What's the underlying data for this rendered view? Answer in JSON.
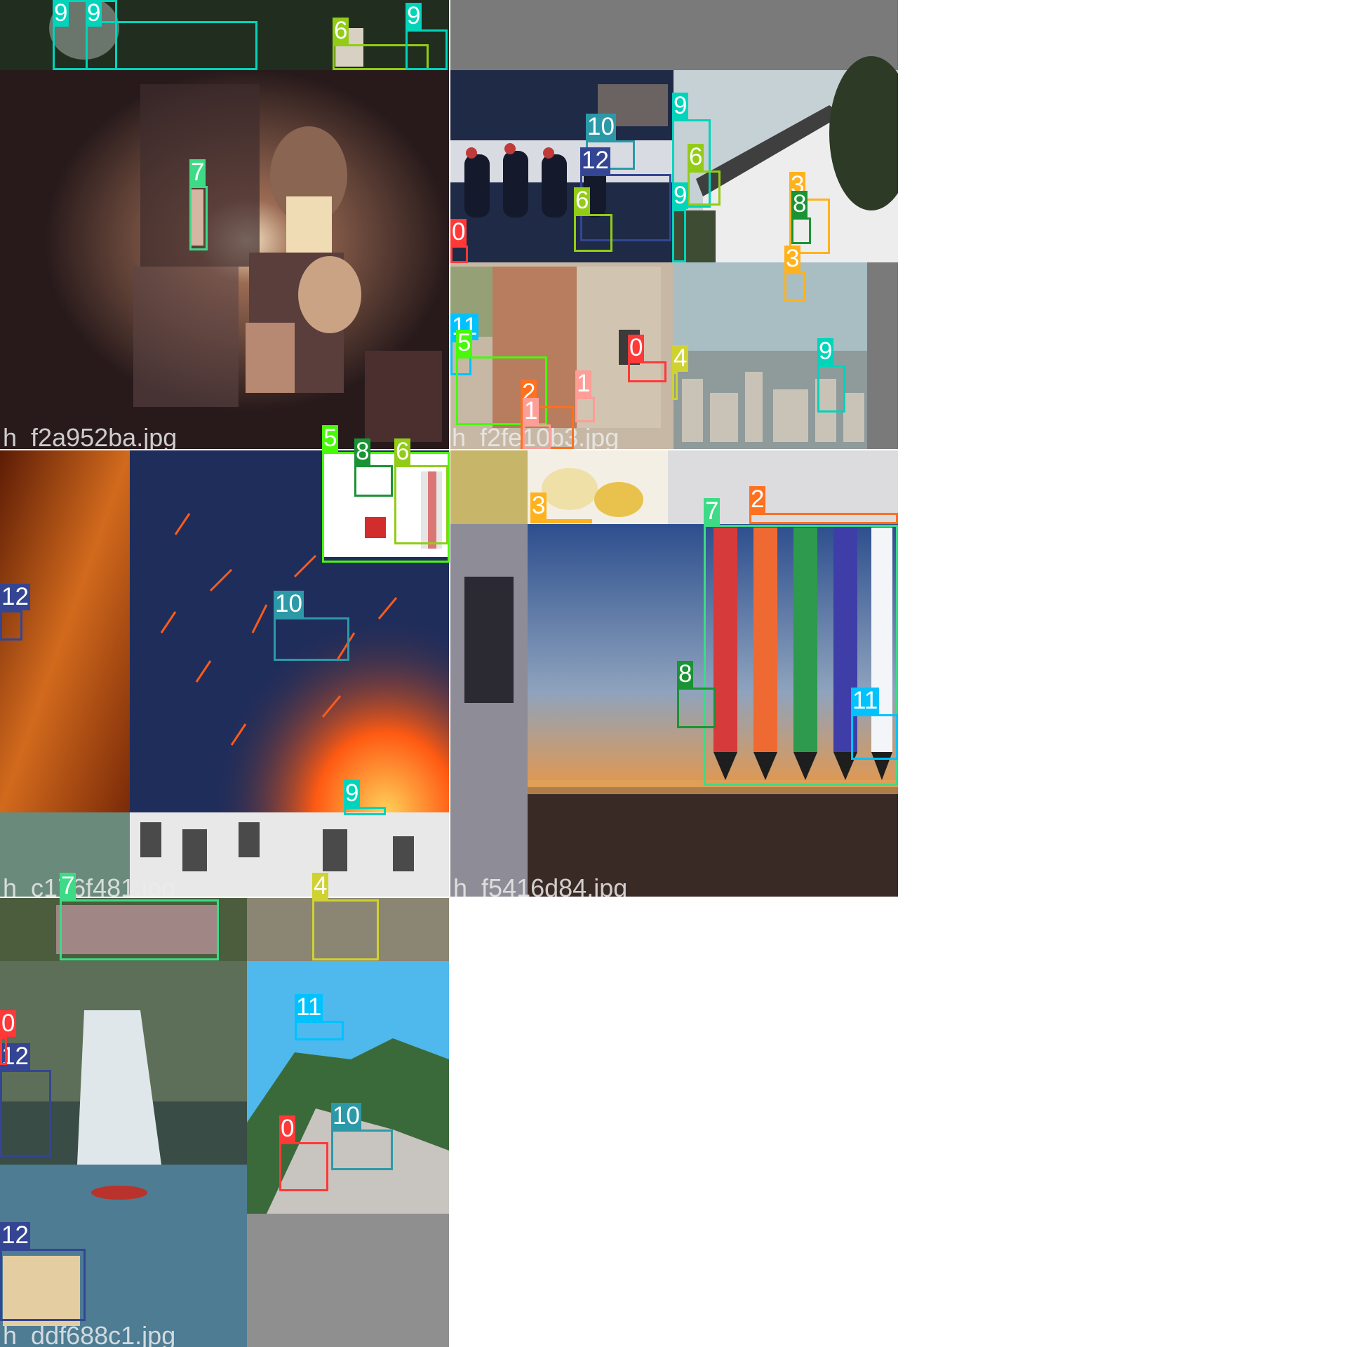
{
  "filenames": {
    "tile1": "h_f2a952ba.jpg",
    "tile2": "h_f2fe10b3.jpg",
    "tile3": "h_c176f481.jpg",
    "tile4": "h_f5416d84.jpg",
    "tile5": "h_ddf688c1.jpg"
  },
  "class_colors": {
    "0": "#ff3838",
    "1": "#ff9d97",
    "2": "#ff701f",
    "3": "#ffb21d",
    "4": "#cfd231",
    "5": "#48f90a",
    "6": "#92cc17",
    "7": "#3ddb86",
    "8": "#1a9334",
    "9": "#00d4bb",
    "10": "#2c99a8",
    "11": "#00c2ff",
    "12": "#344593"
  },
  "detections": [
    {
      "label": "9"
    },
    {
      "label": "9"
    },
    {
      "label": "6"
    },
    {
      "label": "9"
    },
    {
      "label": "7"
    },
    {
      "label": "10"
    },
    {
      "label": "12"
    },
    {
      "label": "6"
    },
    {
      "label": "0"
    },
    {
      "label": "9"
    },
    {
      "label": "6"
    },
    {
      "label": "9"
    },
    {
      "label": "3"
    },
    {
      "label": "8"
    },
    {
      "label": "3"
    },
    {
      "label": "11"
    },
    {
      "label": "5"
    },
    {
      "label": "0"
    },
    {
      "label": "4"
    },
    {
      "label": "1"
    },
    {
      "label": "2"
    },
    {
      "label": "9"
    },
    {
      "label": "1"
    },
    {
      "label": "5"
    },
    {
      "label": "8"
    },
    {
      "label": "6"
    },
    {
      "label": "12"
    },
    {
      "label": "10"
    },
    {
      "label": "9"
    },
    {
      "label": "3"
    },
    {
      "label": "2"
    },
    {
      "label": "7"
    },
    {
      "label": "8"
    },
    {
      "label": "11"
    },
    {
      "label": "7"
    },
    {
      "label": "4"
    },
    {
      "label": "0"
    },
    {
      "label": "12"
    },
    {
      "label": "11"
    },
    {
      "label": "10"
    },
    {
      "label": "0"
    },
    {
      "label": "12"
    }
  ]
}
